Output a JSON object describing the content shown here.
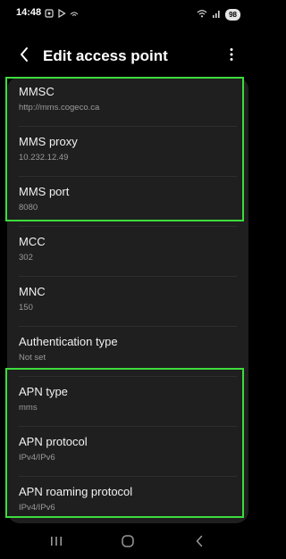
{
  "status_bar": {
    "time": "14:48",
    "battery": "98",
    "left_icons": [
      "screenshot-icon",
      "play-icon",
      "wifi-calling-icon"
    ],
    "right_icons": [
      "wifi-icon",
      "signal-icon"
    ]
  },
  "header": {
    "title": "Edit access point",
    "back_icon": "chevron-left-icon",
    "more_icon": "more-vertical-icon"
  },
  "settings": [
    {
      "title": "MMSC",
      "value": "http://mms.cogeco.ca"
    },
    {
      "title": "MMS proxy",
      "value": "10.232.12.49"
    },
    {
      "title": "MMS port",
      "value": "8080"
    },
    {
      "title": "MCC",
      "value": "302"
    },
    {
      "title": "MNC",
      "value": "150"
    },
    {
      "title": "Authentication type",
      "value": "Not set"
    },
    {
      "title": "APN type",
      "value": "mms"
    },
    {
      "title": "APN protocol",
      "value": "IPv4/IPv6"
    },
    {
      "title": "APN roaming protocol",
      "value": "IPv4/IPv6"
    }
  ],
  "nav_bar": {
    "icons": [
      "recent-apps-icon",
      "home-icon",
      "back-icon"
    ]
  },
  "colors": {
    "background": "#000000",
    "card": "#1f1f1f",
    "highlight": "#3ddc3d",
    "primary_text": "#f2f2f2",
    "secondary_text": "#9a9a9a"
  }
}
